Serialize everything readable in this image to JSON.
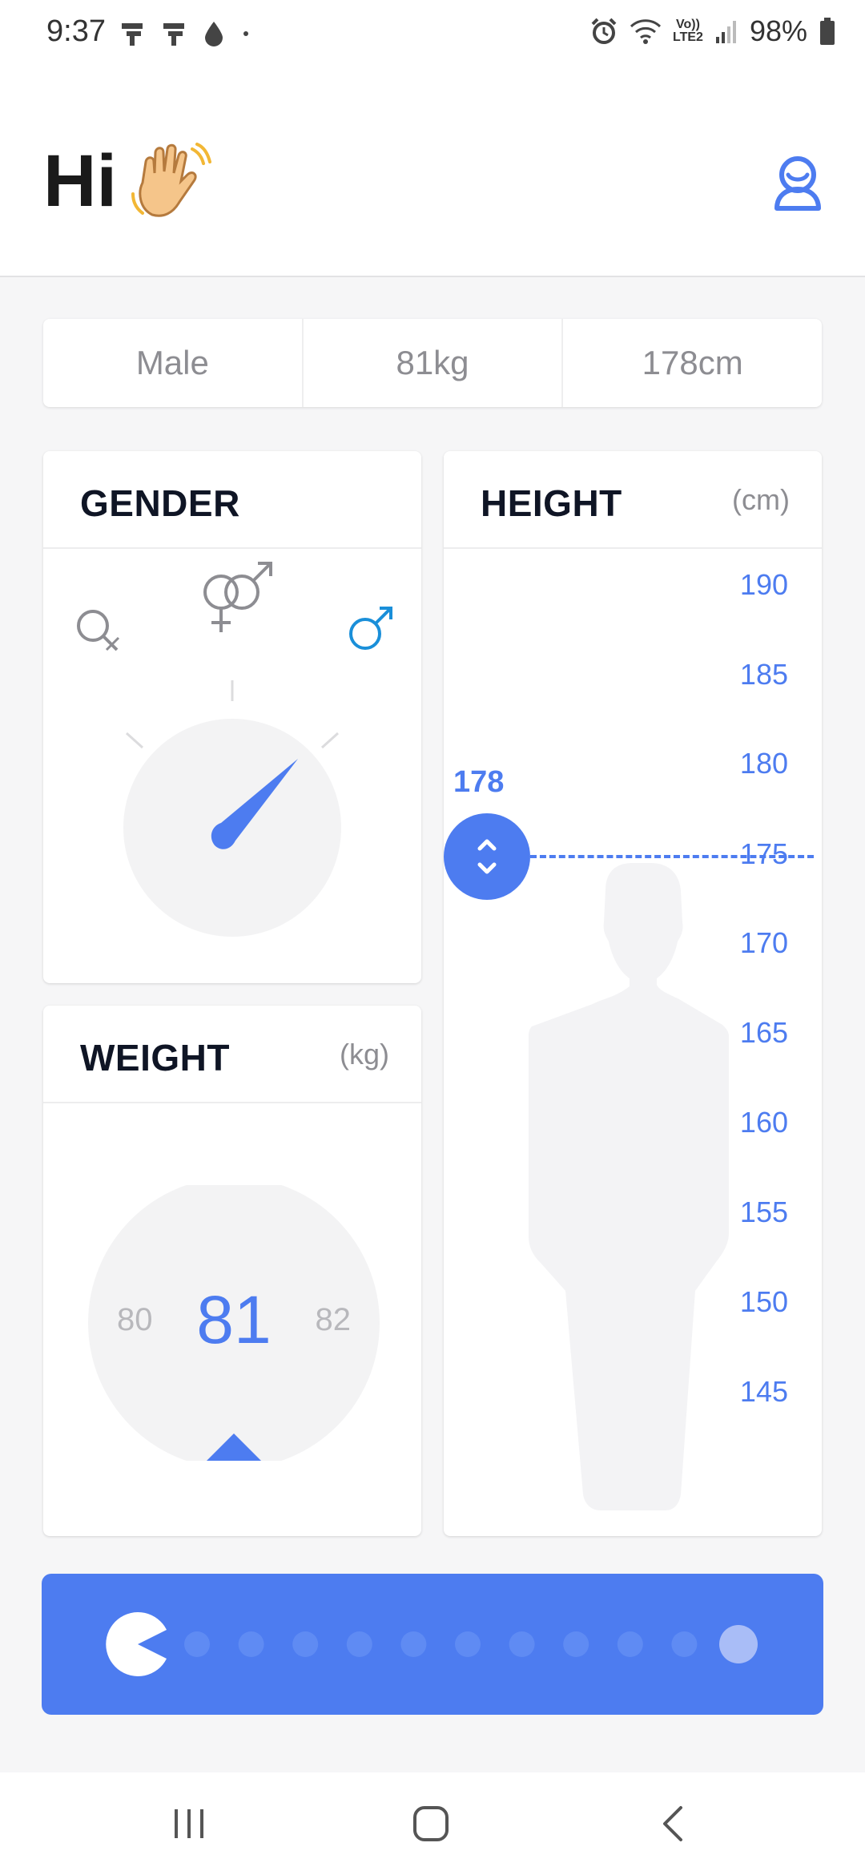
{
  "status_bar": {
    "time": "9:37",
    "lte_top": "Vo))",
    "lte_bottom": "LTE2",
    "battery": "98%"
  },
  "header": {
    "greeting": "Hi",
    "emoji_icon": "waving-hand-icon",
    "profile_icon": "user-profile-icon"
  },
  "summary": {
    "gender": "Male",
    "weight": "81kg",
    "height": "178cm"
  },
  "gender_card": {
    "title": "GENDER",
    "options": [
      "female",
      "other",
      "male"
    ],
    "selected": "male"
  },
  "weight_card": {
    "title": "WEIGHT",
    "unit": "(kg)",
    "prev": "80",
    "current": "81",
    "next": "82"
  },
  "height_card": {
    "title": "HEIGHT",
    "unit": "(cm)",
    "value": "178",
    "scale": [
      "190",
      "185",
      "180",
      "175",
      "170",
      "165",
      "160",
      "155",
      "150",
      "145"
    ]
  },
  "progress": {
    "total_dots": 11,
    "current_step": 1
  },
  "colors": {
    "accent": "#4d7cf0",
    "male": "#1a8fd9",
    "muted": "#8d8d92",
    "silhouette": "#f3f3f5"
  }
}
